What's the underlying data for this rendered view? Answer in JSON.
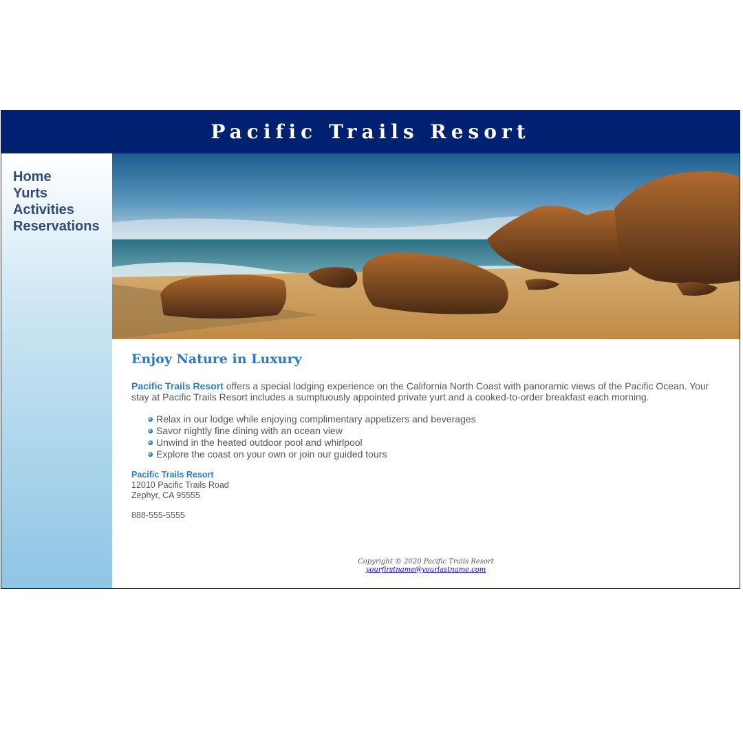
{
  "header": {
    "title": "Pacific Trails Resort"
  },
  "nav": {
    "items": [
      {
        "label": "Home"
      },
      {
        "label": "Yurts"
      },
      {
        "label": "Activities"
      },
      {
        "label": "Reservations"
      }
    ]
  },
  "hero": {
    "alt": "beach"
  },
  "main": {
    "heading": "Enjoy Nature in Luxury",
    "intro_brand": "Pacific Trails Resort",
    "intro_text": " offers a special lodging experience on the California North Coast with panoramic views of the Pacific Ocean. Your stay at Pacific Trails Resort includes a sumptuously appointed private yurt and a cooked-to-order breakfast each morning.",
    "features": [
      "Relax in our lodge while enjoying complimentary appetizers and beverages",
      "Savor nightly fine dining with an ocean view",
      "Unwind in the heated outdoor pool and whirlpool",
      "Explore the coast on your own or join our guided tours"
    ],
    "address": {
      "name": "Pacific Trails Resort",
      "street": "12010 Pacific Trails Road",
      "city": "Zephyr, CA 95555"
    },
    "phone": "888-555-5555"
  },
  "footer": {
    "copyright": "Copyright © 2020 Pacific Trails Resort",
    "email": "yourfirstname@yourlastname.com"
  },
  "colors": {
    "header_bg": "#002171",
    "accent": "#2c7bc9",
    "nav_text": "#344a7b",
    "body_text": "#555555"
  }
}
